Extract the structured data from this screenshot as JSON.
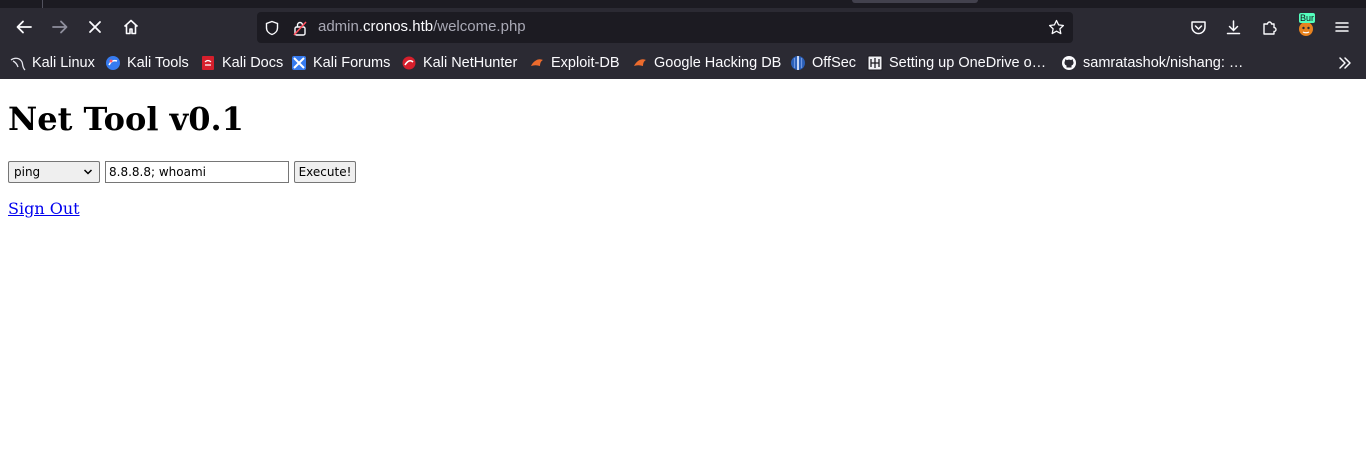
{
  "browser": {
    "url_host_prefix": "admin.",
    "url_host_domain": "cronos.htb",
    "url_path": "/welcome.php",
    "extension_badge": "Bur"
  },
  "bookmarks": [
    {
      "label": "Kali Linux",
      "icon": "kali-dragon-icon"
    },
    {
      "label": "Kali Tools",
      "icon": "kali-tools-icon"
    },
    {
      "label": "Kali Docs",
      "icon": "kali-docs-icon"
    },
    {
      "label": "Kali Forums",
      "icon": "kali-forums-icon"
    },
    {
      "label": "Kali NetHunter",
      "icon": "kali-nethunter-icon"
    },
    {
      "label": "Exploit-DB",
      "icon": "exploit-db-icon"
    },
    {
      "label": "Google Hacking DB",
      "icon": "ghdb-icon"
    },
    {
      "label": "OffSec",
      "icon": "offsec-icon"
    },
    {
      "label": "Setting up OneDrive o…",
      "icon": "onedrive-guide-icon"
    },
    {
      "label": "samratashok/nishang: …",
      "icon": "github-icon"
    }
  ],
  "page": {
    "title": "Net Tool v0.1",
    "command_select_value": "ping",
    "host_input_value": "8.8.8.8; whoami",
    "execute_label": "Execute!",
    "signout_label": "Sign Out"
  },
  "colors": {
    "chrome_bg": "#2b2a33",
    "urlbar_bg": "#1c1b22",
    "link": "#0000ee"
  }
}
